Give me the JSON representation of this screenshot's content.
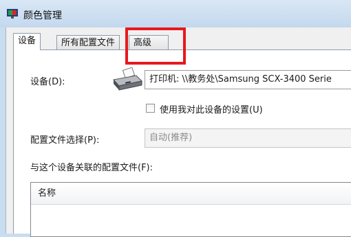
{
  "window": {
    "title": "颜色管理"
  },
  "tabs": [
    {
      "label": "设备"
    },
    {
      "label": "所有配置文件"
    },
    {
      "label": "高级"
    }
  ],
  "device": {
    "label": "设备(D):",
    "selected": "打印机: \\\\教务处\\Samsung SCX-3400 Serie"
  },
  "use_settings": {
    "label": "使用我对此设备的设置(U)",
    "checked": false
  },
  "profile_selection": {
    "label": "配置文件选择(P):",
    "value": "自动(推荐)"
  },
  "associated_profiles": {
    "label": "与这个设备关联的配置文件(F):",
    "columns": [
      "名称"
    ]
  },
  "colors": {
    "highlight": "#e8181e",
    "titlebar": "#c9ddf0"
  }
}
